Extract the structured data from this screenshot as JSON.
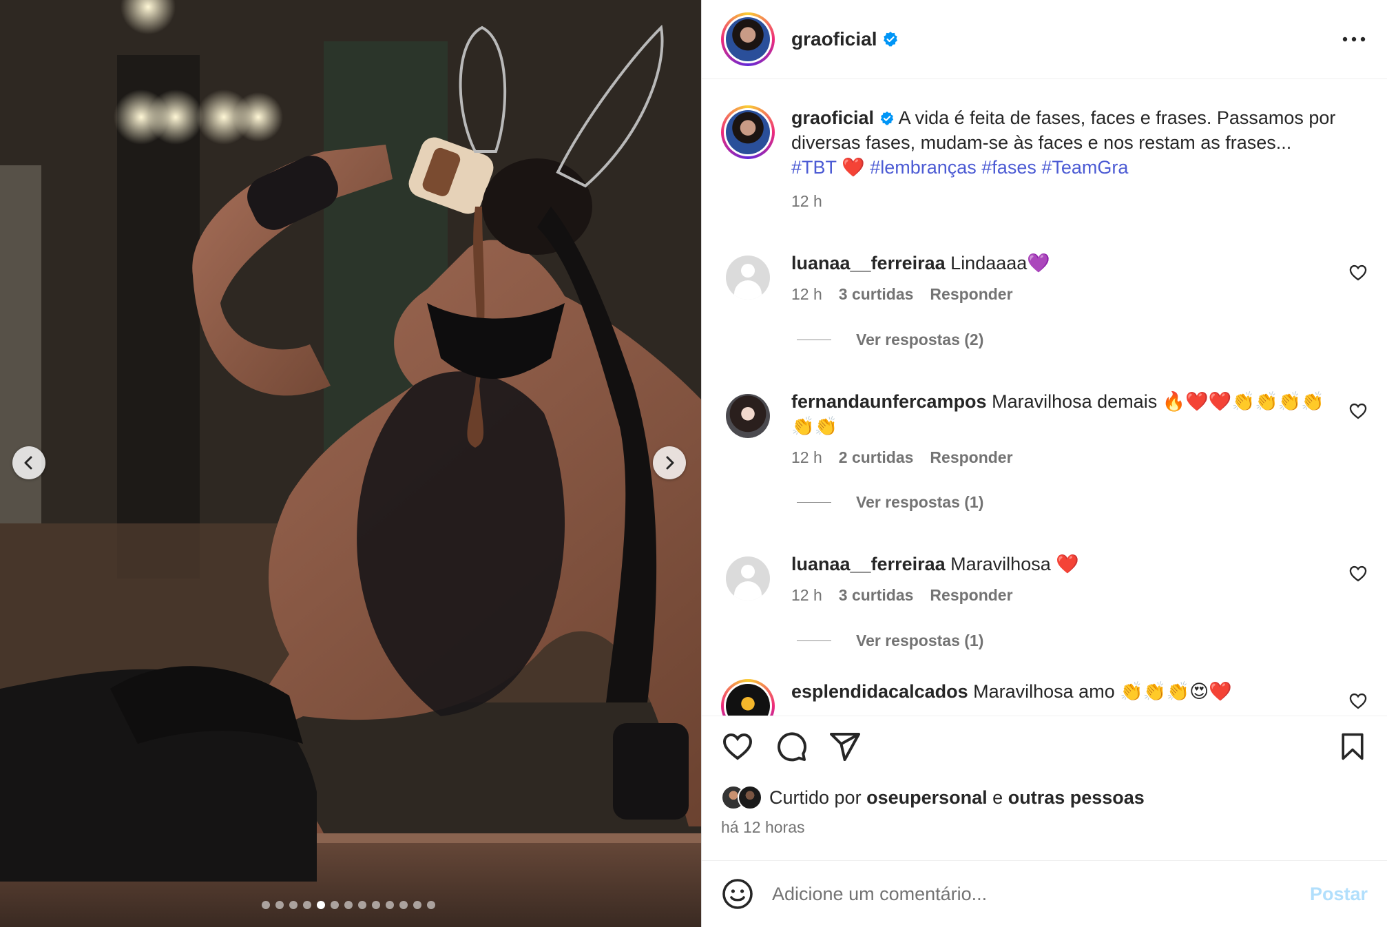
{
  "post": {
    "username": "graoficial",
    "verified": true,
    "caption_text": "A vida é feita de fases, faces e frases. Passamos por diversas fases, mudam-se às faces e nos restam as frases...",
    "caption_tags": [
      "#TBT",
      "❤️",
      "#lembranças",
      "#fases",
      "#TeamGra"
    ],
    "caption_time": "12 h",
    "carousel": {
      "total": 13,
      "active_index": 4
    }
  },
  "comments": [
    {
      "username": "luanaa__ferreiraa",
      "text": "Lindaaaa💜",
      "time": "12 h",
      "likes": "3 curtidas",
      "reply": "Responder",
      "view_replies": "Ver respostas (2)"
    },
    {
      "username": "fernandaunfercampos",
      "text": "Maravilhosa demais 🔥❤️❤️👏👏👏👏👏👏",
      "time": "12 h",
      "likes": "2 curtidas",
      "reply": "Responder",
      "view_replies": "Ver respostas (1)"
    },
    {
      "username": "luanaa__ferreiraa",
      "text": "Maravilhosa ❤️",
      "time": "12 h",
      "likes": "3 curtidas",
      "reply": "Responder",
      "view_replies": "Ver respostas (1)"
    },
    {
      "username": "esplendidacalcados",
      "text": "Maravilhosa amo 👏👏👏😍❤️"
    }
  ],
  "liked_by": {
    "prefix": "Curtido por",
    "user": "oseupersonal",
    "connector": "e",
    "others": "outras pessoas"
  },
  "time_ago": "há 12 horas",
  "comment_input": {
    "placeholder": "Adicione um comentário..."
  },
  "post_button": "Postar",
  "colors": {
    "link": "#4c5bd4",
    "post_button_disabled": "#b2dffc",
    "verified": "#0095f6"
  }
}
